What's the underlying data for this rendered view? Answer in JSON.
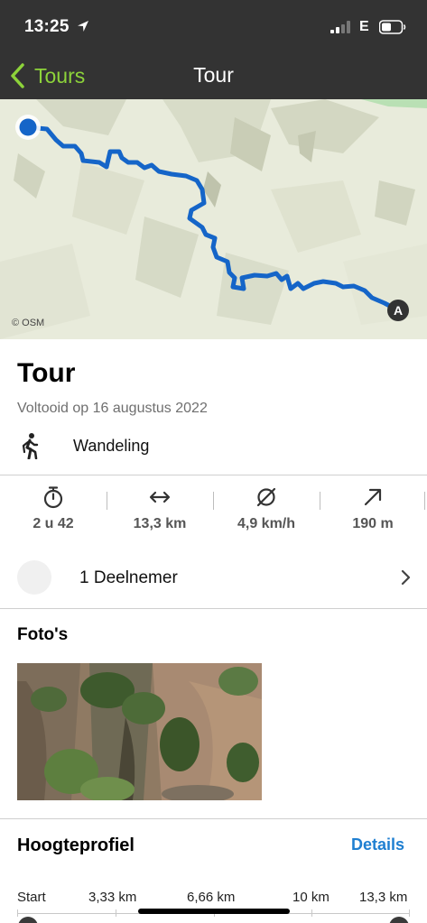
{
  "status_bar": {
    "time": "13:25",
    "network": "E"
  },
  "nav": {
    "back_label": "Tours",
    "title": "Tour"
  },
  "map": {
    "credit": "© OSM",
    "end_marker": "A",
    "route_color": "#1565c8"
  },
  "tour": {
    "title": "Tour",
    "completed": "Voltooid op 16 augustus 2022",
    "activity": "Wandeling",
    "activity_icon": "hiking-icon"
  },
  "stats": [
    {
      "icon": "stopwatch-icon",
      "value": "2 u 42"
    },
    {
      "icon": "distance-icon",
      "value": "13,3 km"
    },
    {
      "icon": "average-speed-icon",
      "value": "4,9 km/h"
    },
    {
      "icon": "ascent-icon",
      "value": "190 m"
    }
  ],
  "participants": {
    "label": "1 Deelnemer"
  },
  "photos": {
    "title": "Foto's"
  },
  "elevation": {
    "title": "Hoogteprofiel",
    "details_label": "Details",
    "axis_labels": [
      "Start",
      "3,33 km",
      "6,66 km",
      "10 km",
      "13,3 km"
    ]
  },
  "colors": {
    "header_bg": "#333333",
    "accent_green": "#8dd33a",
    "link_blue": "#1f7fd1"
  }
}
